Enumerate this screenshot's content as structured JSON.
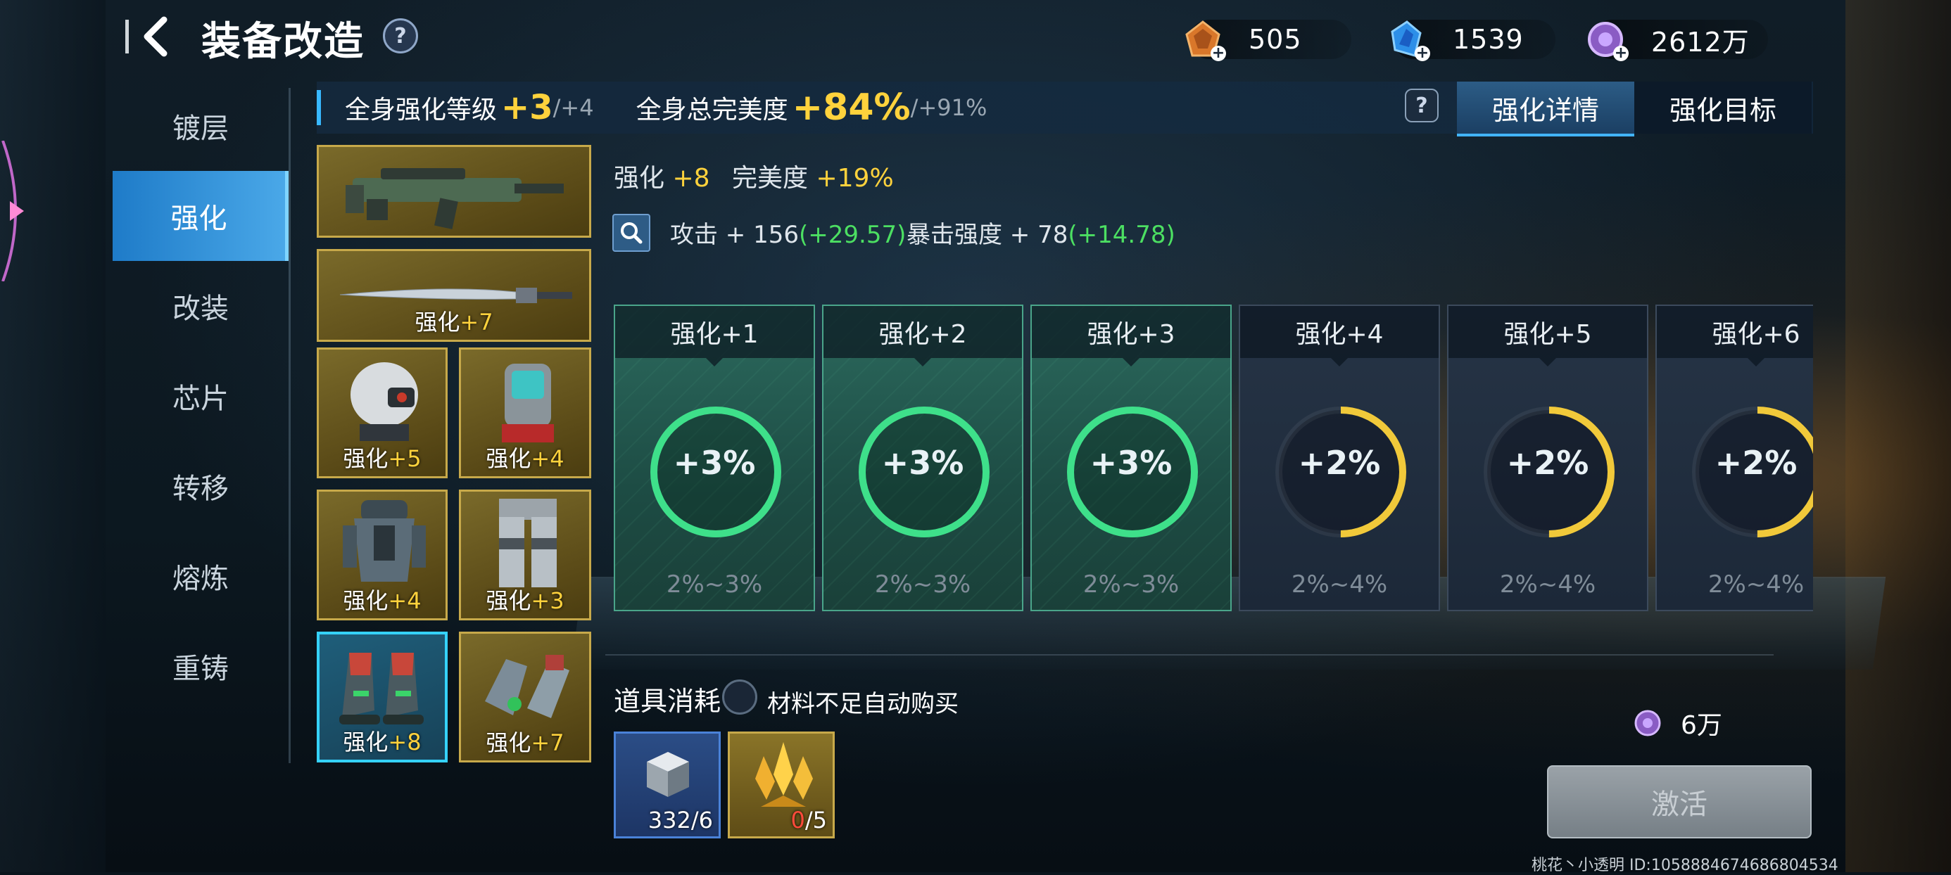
{
  "header": {
    "title": "装备改造",
    "help": "?"
  },
  "currencies": [
    {
      "name": "orange-gem",
      "value": "505",
      "color": "#e07a2a"
    },
    {
      "name": "blue-crystal",
      "value": "1539",
      "color": "#3aa0ff"
    },
    {
      "name": "purple-coin",
      "value": "2612万",
      "color": "#a57bd8"
    }
  ],
  "nav": [
    {
      "label": "镀层",
      "active": false
    },
    {
      "label": "强化",
      "active": true
    },
    {
      "label": "改装",
      "active": false
    },
    {
      "label": "芯片",
      "active": false
    },
    {
      "label": "转移",
      "active": false
    },
    {
      "label": "熔炼",
      "active": false
    },
    {
      "label": "重铸",
      "active": false
    }
  ],
  "summary": {
    "level_label": "全身强化等级",
    "level_value": "+3",
    "level_max": "/+4",
    "perfect_label": "全身总完美度",
    "perfect_value": "+84%",
    "perfect_max": "/+91%"
  },
  "tabs": [
    {
      "label": "强化详情",
      "active": true
    },
    {
      "label": "强化目标",
      "active": false
    }
  ],
  "equipment": [
    {
      "slot": "weapon-rifle",
      "level_prefix": "",
      "level": ""
    },
    {
      "slot": "weapon-blade",
      "level_prefix": "强化",
      "level": "+7"
    },
    {
      "slot": "helmet",
      "level_prefix": "强化",
      "level": "+5"
    },
    {
      "slot": "backpack",
      "level_prefix": "强化",
      "level": "+4"
    },
    {
      "slot": "armor",
      "level_prefix": "强化",
      "level": "+4"
    },
    {
      "slot": "pants",
      "level_prefix": "强化",
      "level": "+3"
    },
    {
      "slot": "boots",
      "level_prefix": "强化",
      "level": "+8",
      "selected": true
    },
    {
      "slot": "gloves",
      "level_prefix": "强化",
      "level": "+7"
    }
  ],
  "detail": {
    "enhance_label": "强化",
    "enhance_value": "+8",
    "perfect_label": "完美度",
    "perfect_value": "+19%",
    "attack_label": "攻击 + 156",
    "attack_bonus": "(+29.57)",
    "crit_label": "暴击强度 + 78",
    "crit_bonus": "(+14.78)"
  },
  "cards": [
    {
      "label": "强化+1",
      "pct": "+3%",
      "range": "2%~3%",
      "done": true,
      "fill": 1.0
    },
    {
      "label": "强化+2",
      "pct": "+3%",
      "range": "2%~3%",
      "done": true,
      "fill": 1.0
    },
    {
      "label": "强化+3",
      "pct": "+3%",
      "range": "2%~3%",
      "done": true,
      "fill": 1.0
    },
    {
      "label": "强化+4",
      "pct": "+2%",
      "range": "2%~4%",
      "done": false,
      "fill": 0.5
    },
    {
      "label": "强化+5",
      "pct": "+2%",
      "range": "2%~4%",
      "done": false,
      "fill": 0.5
    },
    {
      "label": "强化+6",
      "pct": "+2%",
      "range": "2%~4%",
      "done": false,
      "fill": 0.5
    }
  ],
  "consume": {
    "label": "道具消耗",
    "auto_buy": "材料不足自动购买",
    "items": [
      {
        "name": "metal-block",
        "have": "332",
        "need": "/6"
      },
      {
        "name": "gold-crystal",
        "have": "0",
        "need": "/5"
      }
    ],
    "cost": "6万",
    "activate": "激活"
  },
  "footer": {
    "uid": "桃花丶小透明  ID:10588846746868045​34"
  }
}
